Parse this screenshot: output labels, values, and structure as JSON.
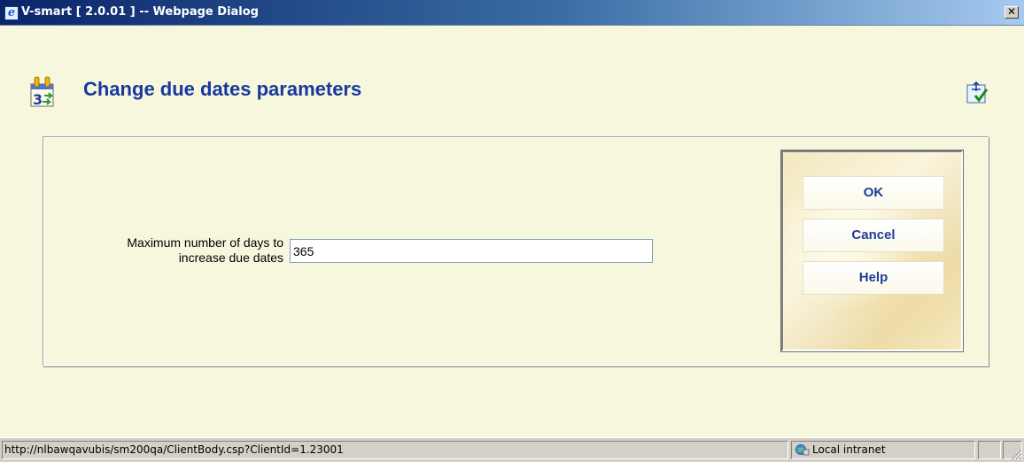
{
  "window": {
    "title": "V-smart [ 2.0.01 ] -- Webpage Dialog",
    "close_glyph": "✕"
  },
  "page": {
    "title": "Change due dates parameters",
    "icon": "calendar-icon",
    "toolbar_icon": "accept-icon"
  },
  "form": {
    "label_line1": "Maximum number of days to",
    "label_line2": "increase due dates",
    "value": "365"
  },
  "buttons": {
    "ok": "OK",
    "cancel": "Cancel",
    "help": "Help"
  },
  "statusbar": {
    "url": "http://nlbawqavubis/sm200qa/ClientBody.csp?ClientId=1.23001",
    "zone": "Local intranet"
  },
  "colors": {
    "title": "#17389f",
    "background": "#f7f7dd",
    "button_text": "#1f3b9c"
  }
}
